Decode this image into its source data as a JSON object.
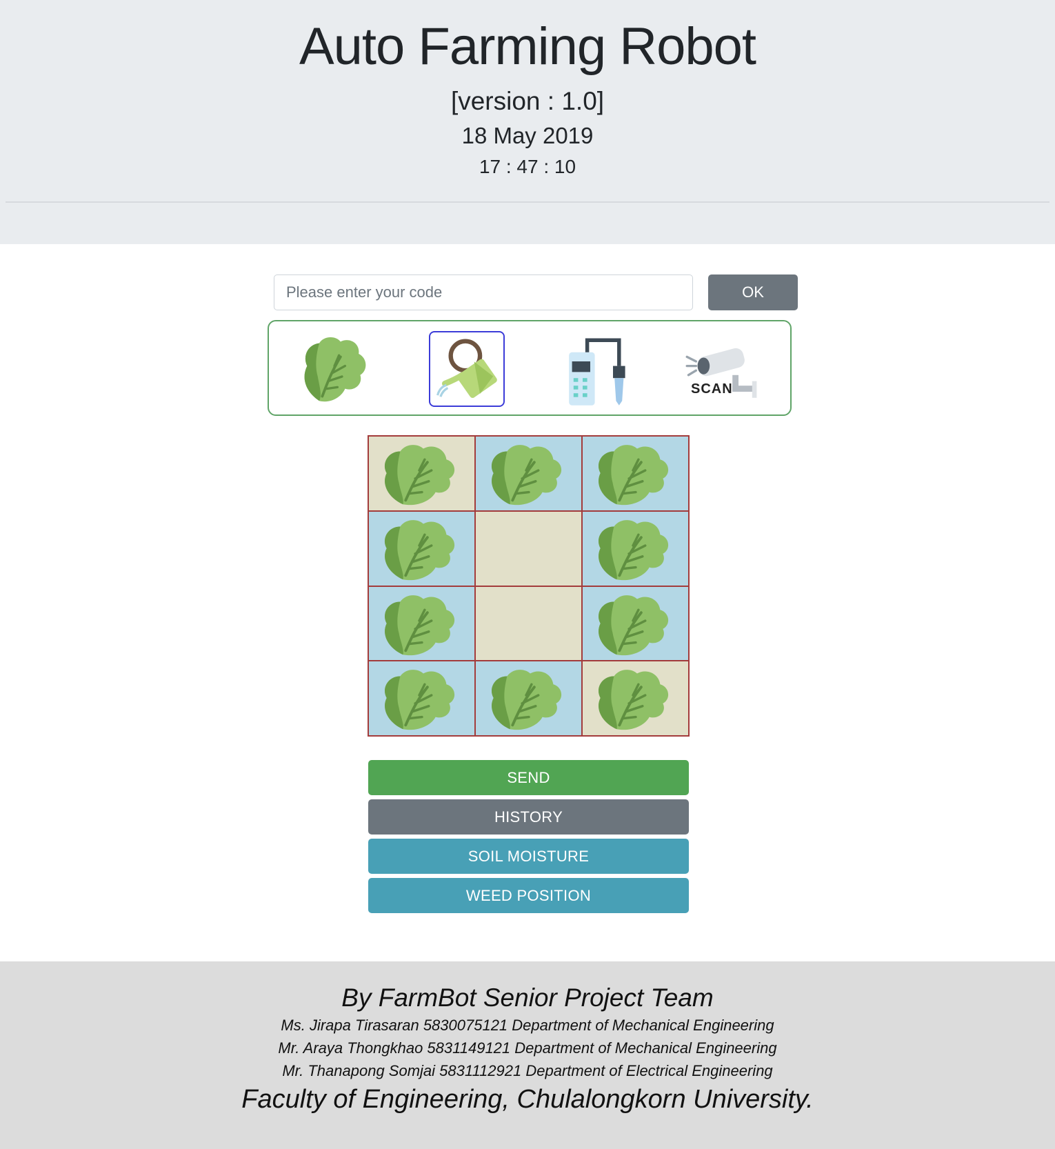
{
  "header": {
    "title": "Auto Farming Robot",
    "version": "[version : 1.0]",
    "date": "18 May 2019",
    "time": "17 : 47 : 10"
  },
  "code_form": {
    "placeholder": "Please enter your code",
    "value": "",
    "ok_label": "OK"
  },
  "tools": [
    {
      "icon": "lettuce-icon",
      "selected": false
    },
    {
      "icon": "watering-can-icon",
      "selected": true
    },
    {
      "icon": "soil-sensor-icon",
      "selected": false
    },
    {
      "icon": "scan-camera-icon",
      "label": "SCAN",
      "selected": false
    }
  ],
  "field_grid": {
    "rows": 4,
    "cols": 3,
    "cells": [
      [
        {
          "plant": true,
          "watered": false
        },
        {
          "plant": true,
          "watered": true
        },
        {
          "plant": true,
          "watered": true
        }
      ],
      [
        {
          "plant": true,
          "watered": true
        },
        {
          "plant": false,
          "watered": false
        },
        {
          "plant": true,
          "watered": true
        }
      ],
      [
        {
          "plant": true,
          "watered": true
        },
        {
          "plant": false,
          "watered": false
        },
        {
          "plant": true,
          "watered": true
        }
      ],
      [
        {
          "plant": true,
          "watered": true
        },
        {
          "plant": true,
          "watered": true
        },
        {
          "plant": true,
          "watered": false
        }
      ]
    ],
    "colors": {
      "watered": "#b3d7e5",
      "dry": "#e2e0c9",
      "border": "#a33b3b"
    }
  },
  "actions": {
    "send": "SEND",
    "history": "HISTORY",
    "soil_moisture": "SOIL MOISTURE",
    "weed_position": "WEED POSITION"
  },
  "colors": {
    "send": "#51a553",
    "history": "#6c757d",
    "info": "#48a0b6",
    "tool_border": "#5fa467",
    "selected_border": "#3b3bd8"
  },
  "footer": {
    "team": "By FarmBot Senior Project Team",
    "members": [
      "Ms. Jirapa Tirasaran 5830075121 Department of Mechanical Engineering",
      "Mr. Araya Thongkhao 5831149121 Department of Mechanical Engineering",
      "Mr. Thanapong Somjai 5831112921 Department of Electrical Engineering"
    ],
    "faculty": "Faculty of Engineering, Chulalongkorn University."
  }
}
